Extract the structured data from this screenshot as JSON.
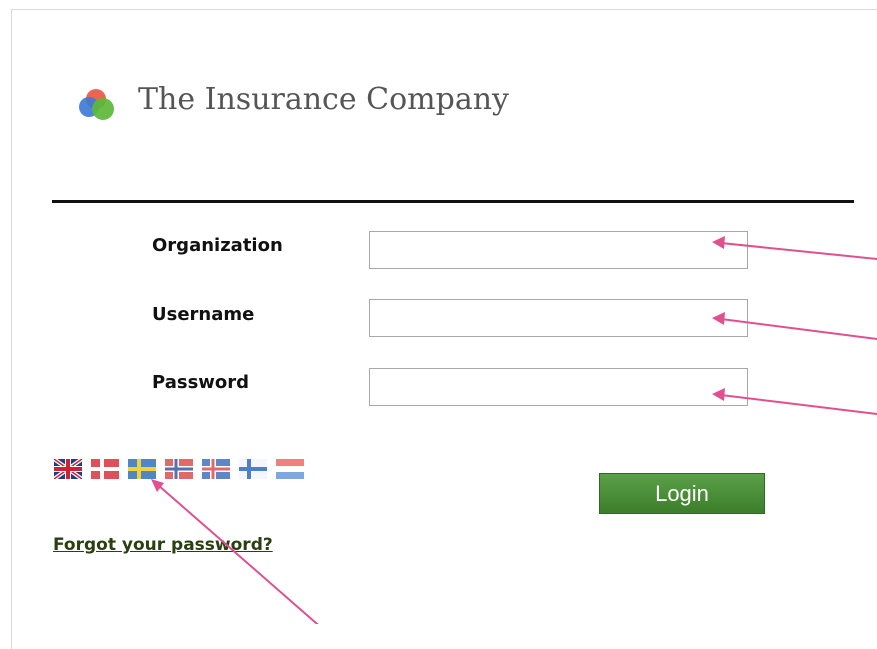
{
  "brand": {
    "name": "The Insurance Company"
  },
  "form": {
    "organization": {
      "label": "Organization",
      "value": "",
      "placeholder": ""
    },
    "username": {
      "label": "Username",
      "value": "",
      "placeholder": ""
    },
    "password": {
      "label": "Password",
      "value": "",
      "placeholder": ""
    },
    "login_label": "Login"
  },
  "languages": [
    {
      "name": "English",
      "icon": "uk-flag-icon"
    },
    {
      "name": "Danish",
      "icon": "denmark-flag-icon"
    },
    {
      "name": "Swedish",
      "icon": "sweden-flag-icon"
    },
    {
      "name": "Norwegian",
      "icon": "norway-flag-icon"
    },
    {
      "name": "Icelandic",
      "icon": "iceland-flag-icon"
    },
    {
      "name": "Finnish",
      "icon": "finland-flag-icon"
    },
    {
      "name": "Dutch",
      "icon": "netherlands-flag-icon"
    }
  ],
  "links": {
    "forgot_password": "Forgot your password?"
  },
  "colors": {
    "login_button": "#4a8f38",
    "link": "#2b3f10",
    "annotation_arrow": "#e0508f",
    "rule": "#111111"
  }
}
